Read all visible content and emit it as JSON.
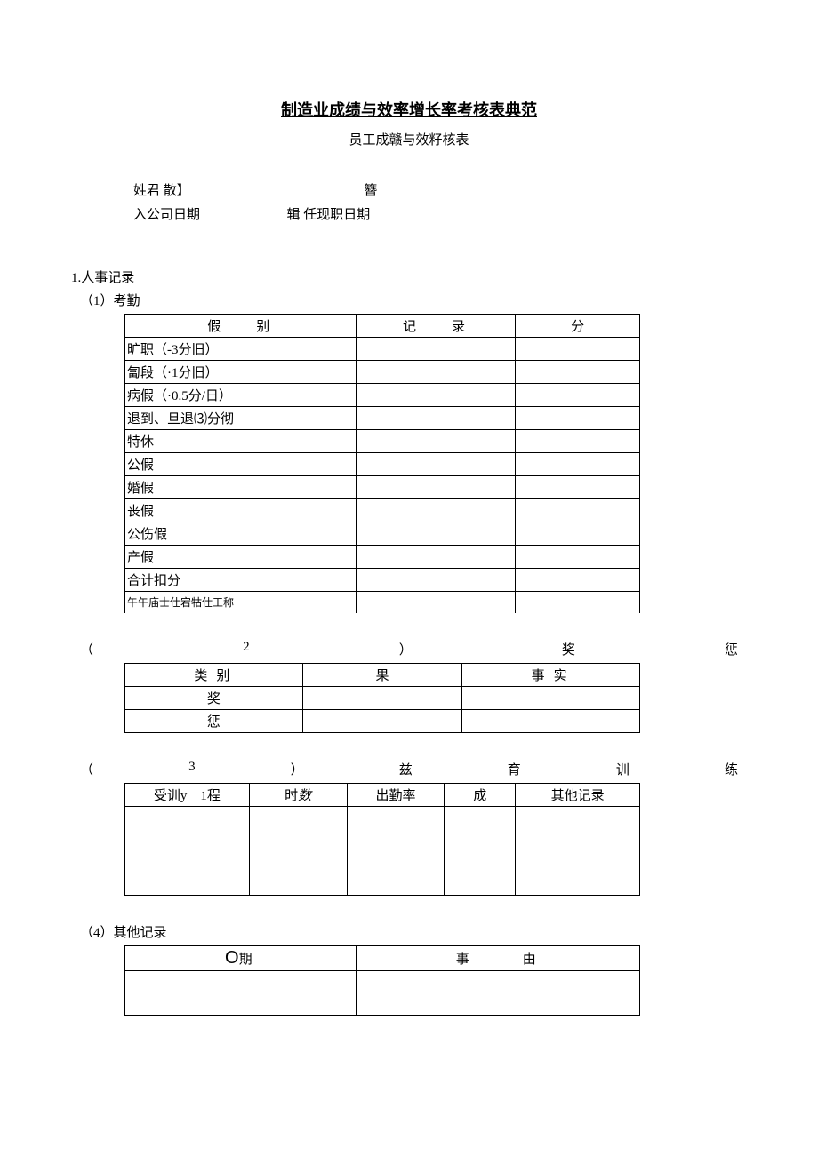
{
  "title": "制造业成绩与效率增长率考核表典范",
  "subtitle": "员工成赣与效籽核表",
  "info": {
    "name_label": "姓君  散】",
    "name_suffix": "簪",
    "join_label": "入公司日期",
    "join_mid": "辑  任现职日期"
  },
  "section1": {
    "num": "1.人事记录",
    "sub1": "（1）考勤",
    "t1": {
      "h1": "假别",
      "h2": "记录",
      "h3": "分",
      "rows": [
        "旷职（-3分旧）",
        "匐段（·1分旧）",
        "病假（·0.5分/日）",
        "退到、旦退⑶分彻",
        "特休",
        "公假",
        "婚假",
        "丧假",
        "公伤假",
        "产假",
        "合计扣分"
      ],
      "cutrow": "午午庙士仕宕牯仕工称"
    },
    "sub2": {
      "p1": "（",
      "p2": "2",
      "p3": "）",
      "p4": "奖",
      "p5": "惩"
    },
    "t2": {
      "h1": "类别",
      "h2": "果",
      "h3": "事实",
      "r1": "奖",
      "r2": "惩"
    },
    "sub3": {
      "p1": "（",
      "p2": "3",
      "p3": "）",
      "p4": "兹",
      "p5": "育",
      "p6": "训",
      "p7": "练"
    },
    "t3": {
      "h1": "受训y　1程",
      "h2": "时",
      "h2i": "数",
      "h3": "出勤率",
      "h4": "成",
      "h5": "其他记录"
    },
    "sub4": "（4）其他记录",
    "t4": {
      "h1a": "O",
      "h1b": "期",
      "h2": "事由"
    }
  }
}
